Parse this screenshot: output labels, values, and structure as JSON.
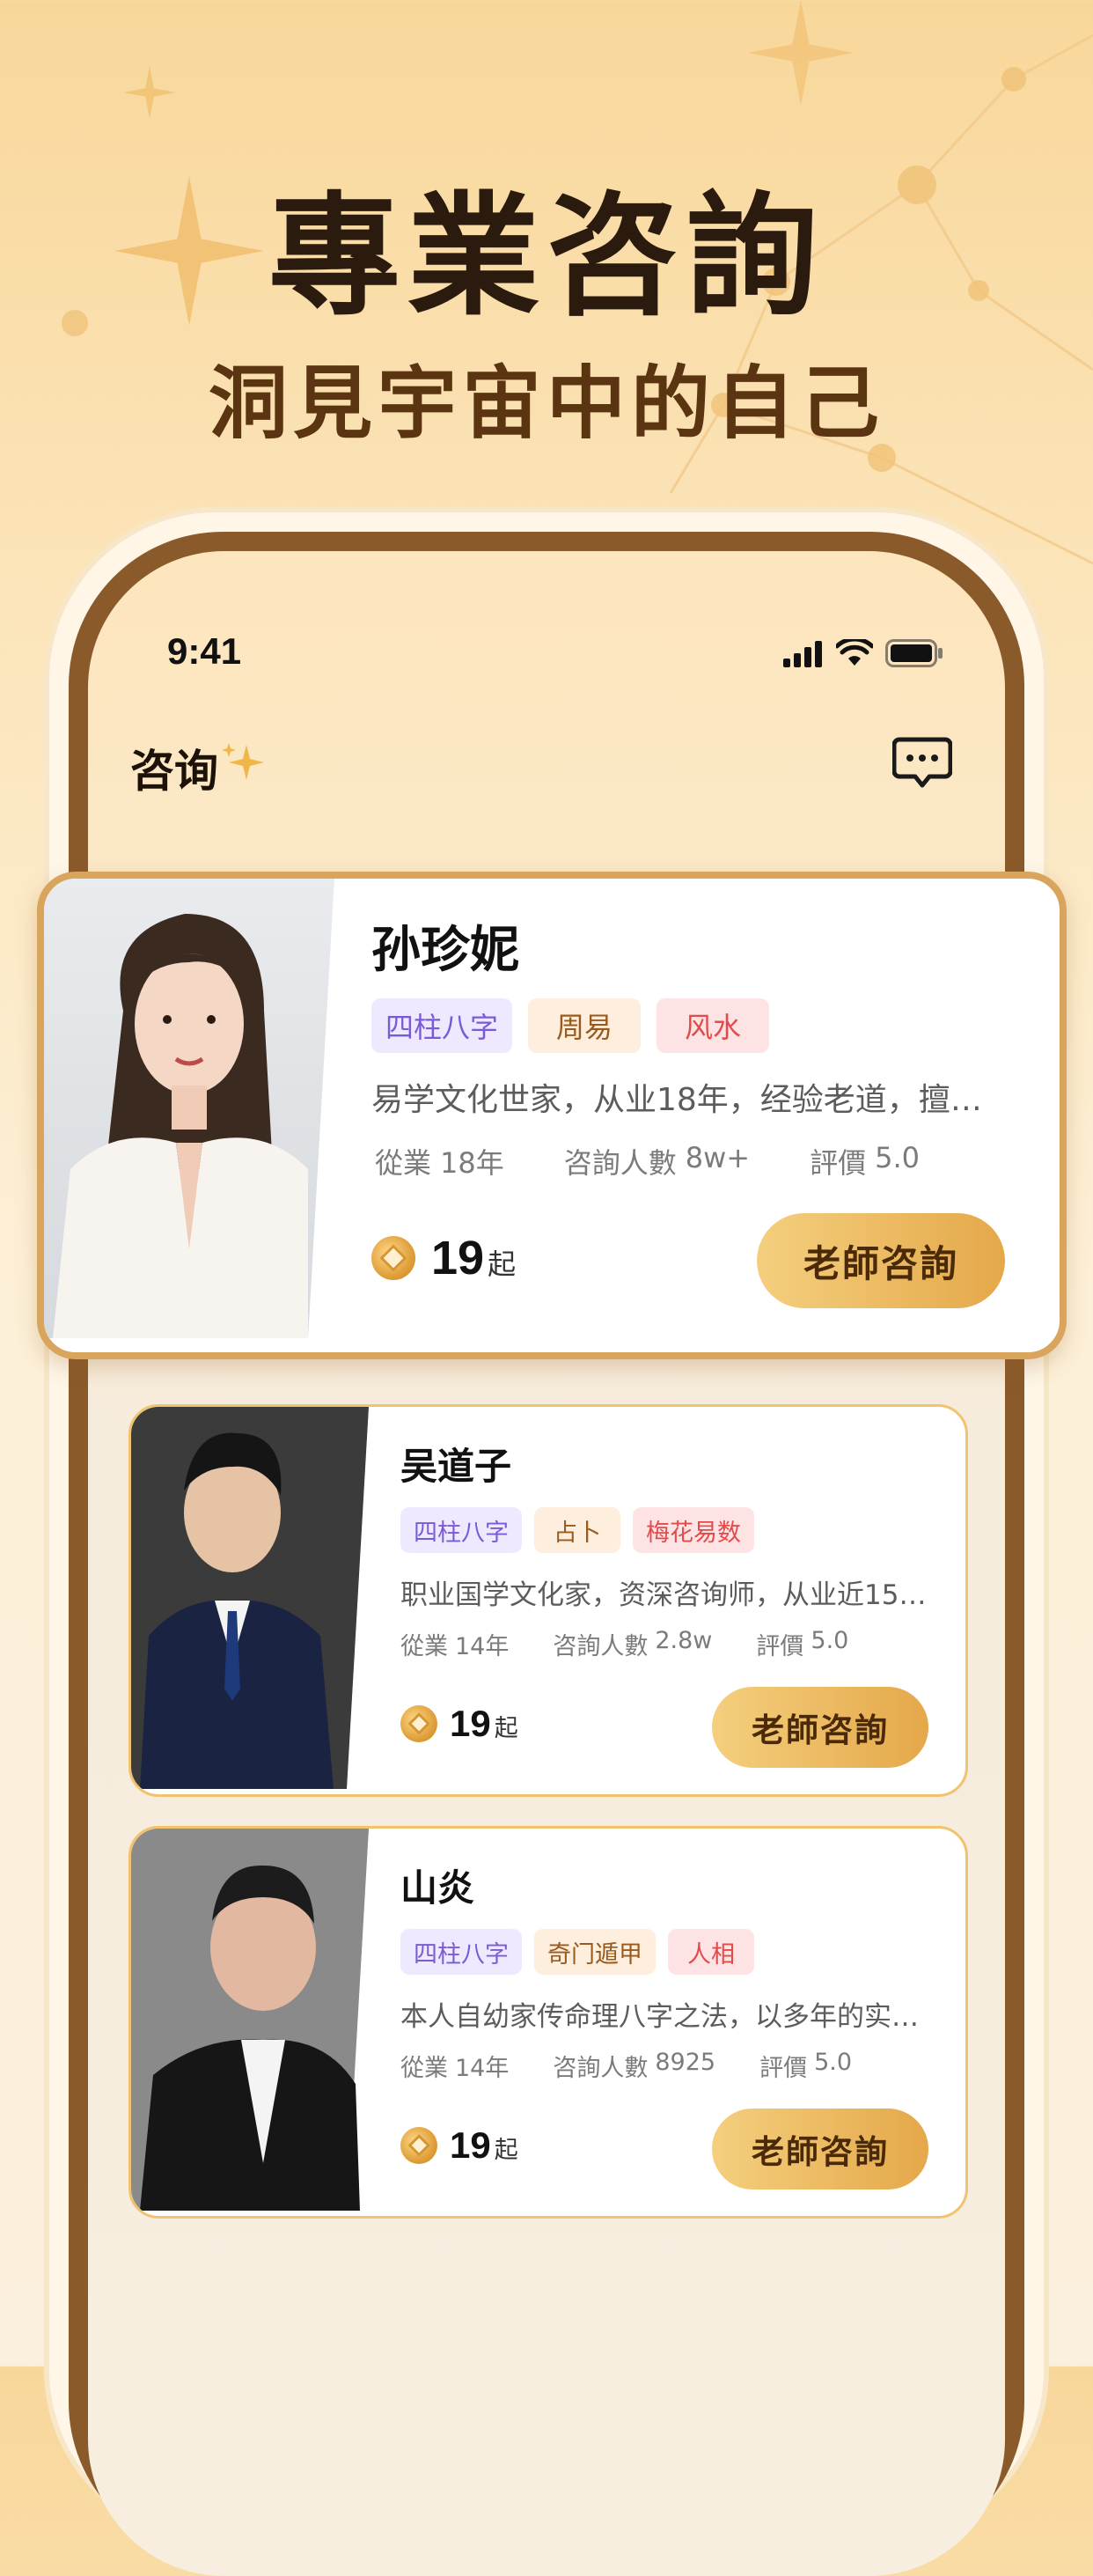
{
  "hero": {
    "title": "專業咨詢",
    "subtitle": "洞見宇宙中的自己"
  },
  "status_bar": {
    "time": "9:41"
  },
  "nav": {
    "title": "咨询",
    "sparkle_icon": "sparkle-icon",
    "message_icon": "chat-bubble-icon"
  },
  "consultants": [
    {
      "name": "孙珍妮",
      "tags": [
        "四柱八字",
        "周易",
        "风水"
      ],
      "description": "易学文化世家，从业18年，经验老道，擅长…",
      "stats": {
        "years_label": "從業",
        "years": "18年",
        "clients_label": "咨詢人數",
        "clients": "8w+",
        "rating_label": "評價",
        "rating": "5.0"
      },
      "price": "19",
      "price_unit": "起",
      "button": "老師咨詢"
    },
    {
      "name": "吴道子",
      "tags": [
        "四柱八字",
        "占卜",
        "梅花易数"
      ],
      "description": "职业国学文化家，资深咨询师，从业近15年…",
      "stats": {
        "years_label": "從業",
        "years": "14年",
        "clients_label": "咨詢人數",
        "clients": "2.8w",
        "rating_label": "評價",
        "rating": "5.0"
      },
      "price": "19",
      "price_unit": "起",
      "button": "老師咨詢"
    },
    {
      "name": "山炎",
      "tags": [
        "四柱八字",
        "奇门遁甲",
        "人相"
      ],
      "description": "本人自幼家传命理八字之法，以多年的实践…",
      "stats": {
        "years_label": "從業",
        "years": "14年",
        "clients_label": "咨詢人數",
        "clients": "8925",
        "rating_label": "評價",
        "rating": "5.0"
      },
      "price": "19",
      "price_unit": "起",
      "button": "老師咨詢"
    }
  ],
  "colors": {
    "accent_gold": "#e5a84a",
    "frame_brown": "#8a5a2b",
    "tag_purple": "#7a5bd6",
    "tag_red": "#e34b4b"
  }
}
